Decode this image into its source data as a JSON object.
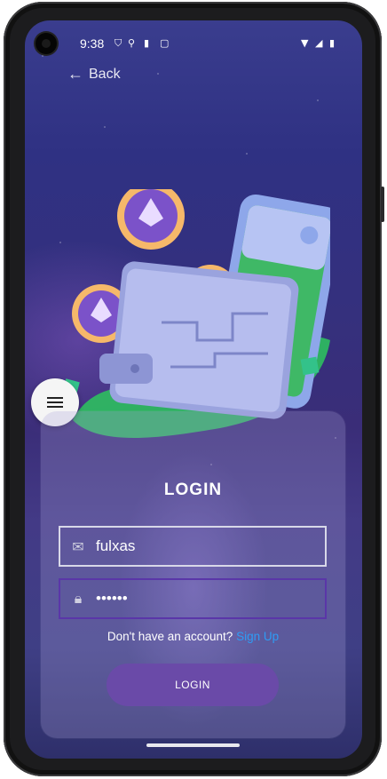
{
  "status": {
    "time": "9:38"
  },
  "nav": {
    "back_label": "Back"
  },
  "login": {
    "title": "LOGIN",
    "username_value": "fulxas",
    "password_value": "••••••",
    "signup_prompt": "Don't have an account?",
    "signup_link": "Sign Up",
    "button_label": "LOGIN"
  },
  "icons": {
    "menu": "hamburger-icon",
    "email": "envelope-icon",
    "password": "lock-icon",
    "back": "arrow-left-icon"
  },
  "colors": {
    "accent": "#6a4aa8",
    "link": "#2e9cf5",
    "password_border": "#5a36a8"
  }
}
